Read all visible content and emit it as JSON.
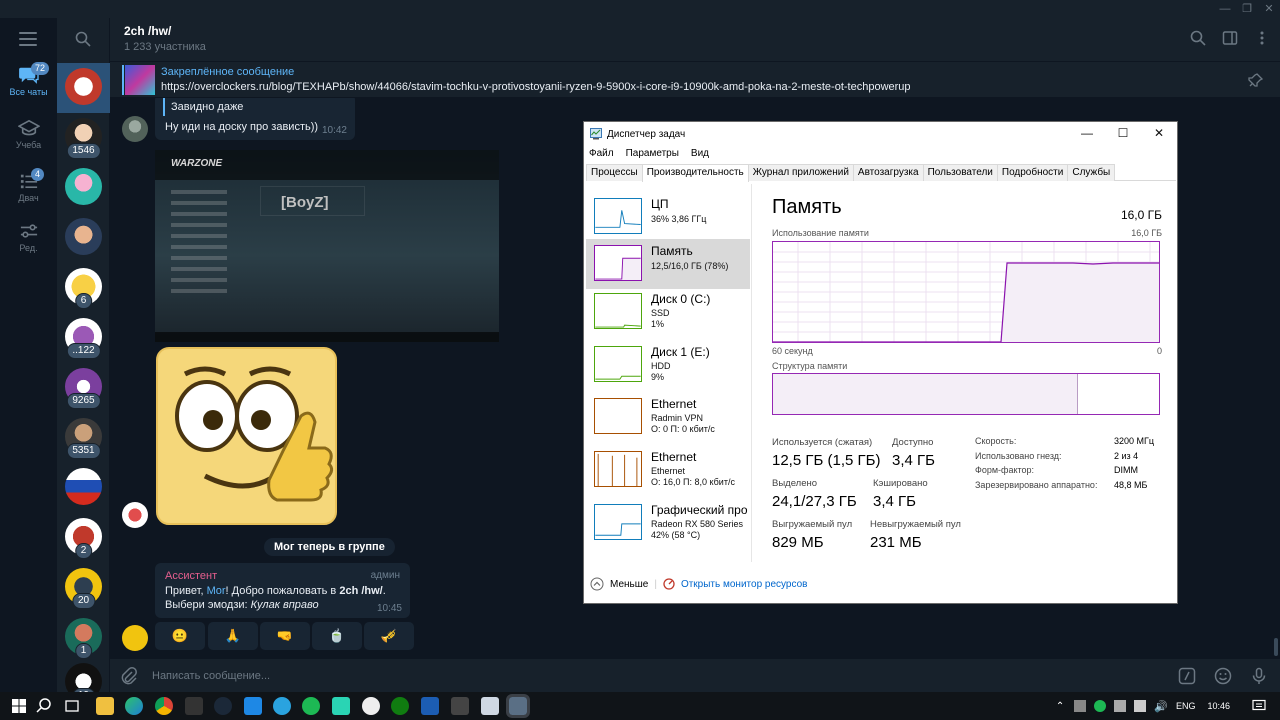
{
  "window": {
    "minimize": "—",
    "maximize": "❐",
    "close": "✕"
  },
  "folders": [
    {
      "label": "Все чаты",
      "badge": "72"
    },
    {
      "label": "Учеба",
      "badge": ""
    },
    {
      "label": "Двач",
      "badge": "4"
    },
    {
      "label": "Ред.",
      "badge": ""
    }
  ],
  "chats": [
    {
      "badge": ""
    },
    {
      "badge": "1546"
    },
    {
      "badge": ""
    },
    {
      "badge": ""
    },
    {
      "badge": "6"
    },
    {
      "badge": "..122"
    },
    {
      "badge": "9265"
    },
    {
      "badge": "5351"
    },
    {
      "badge": ""
    },
    {
      "badge": "2"
    },
    {
      "badge": "20"
    },
    {
      "badge": "1"
    },
    {
      "badge": "19"
    }
  ],
  "chat": {
    "title": "2ch /hw/",
    "subtitle": "1 233 участника",
    "pinned_title": "Закреплённое сообщение",
    "pinned_text": "https://overclockers.ru/blog/TEXHAPb/show/44066/stavim-tochku-v-protivostoyanii-ryzen-9-5900x-i-core-i9-10900k-amd-poka-na-2-meste-ot-techpowerup"
  },
  "messages": {
    "quote_text": "Завидно даже",
    "reply_text": "Ну иди на доску про зависть))",
    "reply_time": "10:42",
    "screenshot_logo": "WARZONE",
    "screenshot_tag": "[BoyZ]",
    "service": "Мог теперь в группе",
    "bot_name": "Ассистент",
    "bot_role": "админ",
    "bot_line1_pre": "Привет, ",
    "bot_line1_name": "Mor",
    "bot_line1_mid": "! Добро пожаловать в ",
    "bot_line1_group": "2ch /hw/",
    "bot_line1_end": ".",
    "bot_line2_pre": "Выбери эмодзи: ",
    "bot_line2_em": "Кулак вправо",
    "bot_time": "10:45",
    "keyboard": [
      "😐",
      "🙏",
      "🤜",
      "🍵",
      "🎺"
    ]
  },
  "input": {
    "placeholder": "Написать сообщение..."
  },
  "taskbar": {
    "lang": "ENG",
    "time": "10:46"
  },
  "taskmgr": {
    "title": "Диспетчер задач",
    "menu": [
      "Файл",
      "Параметры",
      "Вид"
    ],
    "tabs": [
      "Процессы",
      "Производительность",
      "Журнал приложений",
      "Автозагрузка",
      "Пользователи",
      "Подробности",
      "Службы"
    ],
    "sidebar": [
      {
        "name": "ЦП",
        "line1": "36%  3,86 ГГц",
        "line2": "",
        "color": "#117dbb"
      },
      {
        "name": "Память",
        "line1": "12,5/16,0 ГБ (78%)",
        "line2": "",
        "color": "#8b12ae"
      },
      {
        "name": "Диск 0 (C:)",
        "line1": "SSD",
        "line2": "1%",
        "color": "#4da60c"
      },
      {
        "name": "Диск 1 (E:)",
        "line1": "HDD",
        "line2": "9%",
        "color": "#4da60c"
      },
      {
        "name": "Ethernet",
        "line1": "Radmin VPN",
        "line2": "О: 0  П: 0 кбит/с",
        "color": "#a74f01"
      },
      {
        "name": "Ethernet",
        "line1": "Ethernet",
        "line2": "О: 16,0  П: 8,0 кбит/с",
        "color": "#a74f01"
      },
      {
        "name": "Графический про",
        "line1": "Radeon RX 580 Series",
        "line2": "42%  (58 °C)",
        "color": "#117dbb"
      }
    ],
    "main": {
      "title": "Память",
      "total": "16,0 ГБ",
      "usage_label": "Использование памяти",
      "usage_max": "16,0 ГБ",
      "axis_left": "60 секунд",
      "axis_right": "0",
      "composition_label": "Структура памяти",
      "used_label": "Используется (сжатая)",
      "used_value": "12,5 ГБ (1,5 ГБ)",
      "avail_label": "Доступно",
      "avail_value": "3,4 ГБ",
      "committed_label": "Выделено",
      "committed_value": "24,1/27,3 ГБ",
      "cached_label": "Кэшировано",
      "cached_value": "3,4 ГБ",
      "paged_label": "Выгружаемый пул",
      "paged_value": "829 МБ",
      "nonpaged_label": "Невыгружаемый пул",
      "nonpaged_value": "231 МБ",
      "speed_label": "Скорость:",
      "speed_value": "3200 МГц",
      "slots_label": "Использовано гнезд:",
      "slots_value": "2 из 4",
      "form_label": "Форм-фактор:",
      "form_value": "DIMM",
      "reserved_label": "Зарезервировано аппаратно:",
      "reserved_value": "48,8 МБ"
    },
    "footer": {
      "less": "Меньше",
      "monitor": "Открыть монитор ресурсов"
    }
  }
}
